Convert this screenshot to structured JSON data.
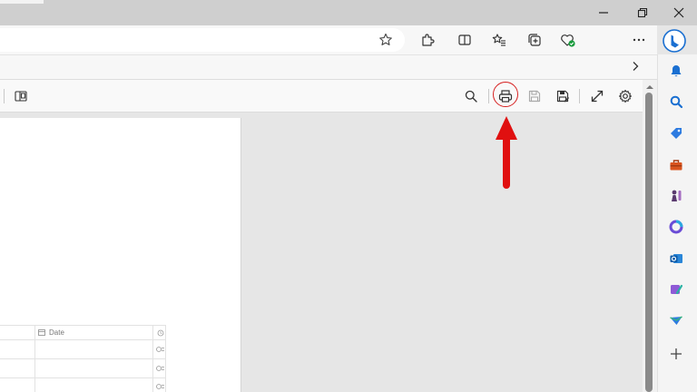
{
  "window": {
    "controls": [
      "minimize-icon",
      "restore-icon",
      "close-icon"
    ]
  },
  "browser_toolbar": {
    "icons": [
      "favorite-star-icon",
      "extensions-icon",
      "split-screen-icon",
      "favorites-icon",
      "collections-icon",
      "browser-essentials-icon",
      "more-icon",
      "bing-copilot-icon"
    ]
  },
  "pdf_toolbar": {
    "icons": [
      "page-view-icon",
      "search-icon",
      "print-icon",
      "save-icon",
      "save-as-icon",
      "fullscreen-icon",
      "settings-icon"
    ]
  },
  "document": {
    "table_header_date": "Date"
  },
  "sidebar": {
    "icons": [
      "notifications-icon",
      "search-icon",
      "shopping-icon",
      "tools-icon",
      "games-icon",
      "microsoft365-icon",
      "outlook-icon",
      "designer-icon",
      "drop-icon",
      "add-icon"
    ]
  },
  "annotation": {
    "color": "#e01010",
    "target": "print-icon"
  }
}
